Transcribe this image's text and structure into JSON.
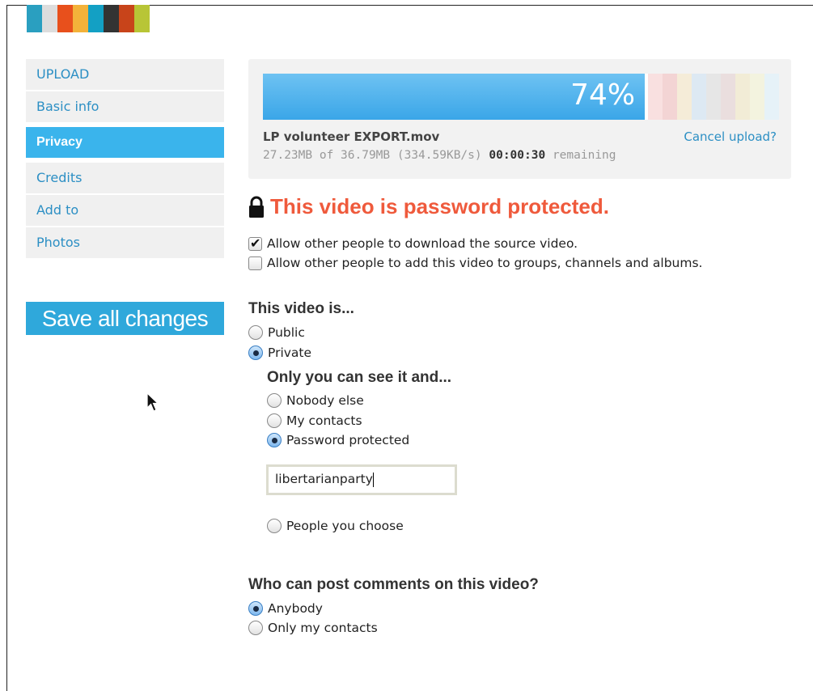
{
  "logo": {
    "colors": [
      "#2a9fc0",
      "#dddddd",
      "#e8501c",
      "#f3b23a",
      "#13a0c4",
      "#333333",
      "#c8441a",
      "#b8c536"
    ]
  },
  "sidebar": {
    "items": [
      {
        "label": "UPLOAD",
        "active": false
      },
      {
        "label": "Basic info",
        "active": false
      },
      {
        "label": "Privacy",
        "active": true
      },
      {
        "label": "Credits",
        "active": false
      },
      {
        "label": "Add to",
        "active": false
      },
      {
        "label": "Photos",
        "active": false
      }
    ],
    "save_label": "Save all changes"
  },
  "upload": {
    "percent_label": "74%",
    "progress": 0.74,
    "file_name": "LP volunteer EXPORT.mov",
    "size_progress": "27.23MB of 36.79MB (334.59KB/s)",
    "time_remaining": "00:00:30",
    "remaining_label": "remaining",
    "cancel_label": "Cancel upload?",
    "stripe_colors": [
      "#f9e0e0",
      "#f3d4d4",
      "#f5ecd8",
      "#dde9f3",
      "#e6e6e6",
      "#eadede",
      "#f2ecd6",
      "#f3f3df",
      "#e6f2f8"
    ]
  },
  "privacy": {
    "heading": "This video is password protected.",
    "download_option": "Allow other people to download the source video.",
    "groups_option": "Allow other people to add this video to groups, channels and albums.",
    "visibility_heading": "This video is...",
    "public_label": "Public",
    "private_label": "Private",
    "private_subheading": "Only you can see it and...",
    "nobody_label": "Nobody else",
    "contacts_label": "My contacts",
    "password_label": "Password protected",
    "password_value": "libertarianparty",
    "people_label": "People you choose",
    "comments_heading": "Who can post comments on this video?",
    "anybody_label": "Anybody",
    "only_contacts_label": "Only my contacts"
  }
}
